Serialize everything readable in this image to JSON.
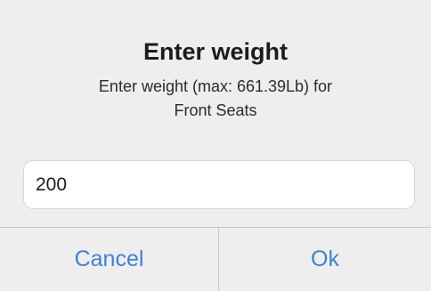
{
  "dialog": {
    "title": "Enter weight",
    "message_line1": "Enter weight (max: 661.39Lb) for",
    "message_line2": "Front Seats",
    "input_value": "200",
    "cancel_label": "Cancel",
    "ok_label": "Ok"
  },
  "colors": {
    "background": "#eeeeef",
    "button_text": "#3f7fd9",
    "separator": "#c9c9cc"
  }
}
